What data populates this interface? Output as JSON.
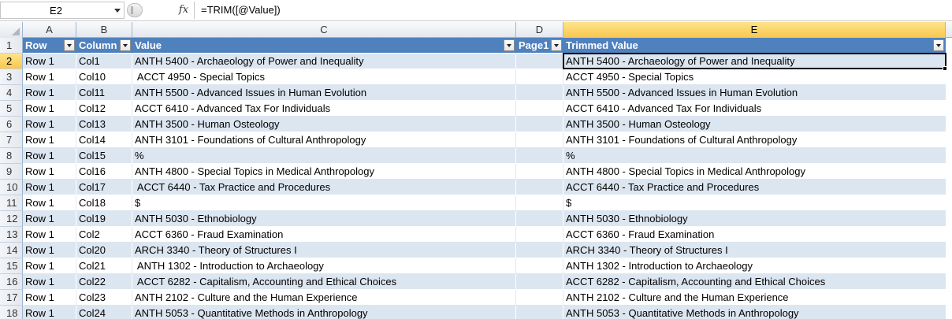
{
  "formula_bar": {
    "name_box": "E2",
    "fx_label": "fx",
    "formula": "=TRIM([@Value])"
  },
  "sheet": {
    "columns": [
      "A",
      "B",
      "C",
      "D",
      "E"
    ],
    "active_column": "E",
    "active_row": "2",
    "header_row": {
      "row_number": "1",
      "cells": [
        "Row",
        "Column",
        "Value",
        "Page1",
        "Trimmed Value"
      ]
    },
    "rows": [
      {
        "n": "2",
        "a": "Row 1",
        "b": "Col1",
        "c": "ANTH 5400 - Archaeology of Power and Inequality",
        "d": "",
        "e": "ANTH 5400 - Archaeology of Power and Inequality"
      },
      {
        "n": "3",
        "a": "Row 1",
        "b": "Col10",
        "c": " ACCT 4950 - Special Topics",
        "d": "",
        "e": "ACCT 4950 - Special Topics"
      },
      {
        "n": "4",
        "a": "Row 1",
        "b": "Col11",
        "c": "ANTH 5500 - Advanced Issues in Human Evolution",
        "d": "",
        "e": "ANTH 5500 - Advanced Issues in Human Evolution"
      },
      {
        "n": "5",
        "a": "Row 1",
        "b": "Col12",
        "c": "ACCT 6410 - Advanced Tax For Individuals",
        "d": "",
        "e": "ACCT 6410 - Advanced Tax For Individuals"
      },
      {
        "n": "6",
        "a": "Row 1",
        "b": "Col13",
        "c": "ANTH 3500 - Human Osteology",
        "d": "",
        "e": "ANTH 3500 - Human Osteology"
      },
      {
        "n": "7",
        "a": "Row 1",
        "b": "Col14",
        "c": "ANTH 3101 - Foundations of Cultural Anthropology",
        "d": "",
        "e": "ANTH 3101 - Foundations of Cultural Anthropology"
      },
      {
        "n": "8",
        "a": "Row 1",
        "b": "Col15",
        "c": "%",
        "d": "",
        "e": "%"
      },
      {
        "n": "9",
        "a": "Row 1",
        "b": "Col16",
        "c": "ANTH 4800 - Special Topics in Medical Anthropology",
        "d": "",
        "e": "ANTH 4800 - Special Topics in Medical Anthropology"
      },
      {
        "n": "10",
        "a": "Row 1",
        "b": "Col17",
        "c": " ACCT 6440 - Tax Practice and Procedures",
        "d": "",
        "e": "ACCT 6440 - Tax Practice and Procedures"
      },
      {
        "n": "11",
        "a": "Row 1",
        "b": "Col18",
        "c": "$",
        "d": "",
        "e": "$"
      },
      {
        "n": "12",
        "a": "Row 1",
        "b": "Col19",
        "c": "ANTH 5030 - Ethnobiology",
        "d": "",
        "e": "ANTH 5030 - Ethnobiology"
      },
      {
        "n": "13",
        "a": "Row 1",
        "b": "Col2",
        "c": "ACCT 6360 - Fraud Examination",
        "d": "",
        "e": "ACCT 6360 - Fraud Examination"
      },
      {
        "n": "14",
        "a": "Row 1",
        "b": "Col20",
        "c": "ARCH 3340 - Theory of Structures I",
        "d": "",
        "e": "ARCH 3340 - Theory of Structures I"
      },
      {
        "n": "15",
        "a": "Row 1",
        "b": "Col21",
        "c": " ANTH 1302 - Introduction to Archaeology",
        "d": "",
        "e": "ANTH 1302 - Introduction to Archaeology"
      },
      {
        "n": "16",
        "a": "Row 1",
        "b": "Col22",
        "c": " ACCT 6282 - Capitalism, Accounting and Ethical Choices",
        "d": "",
        "e": "ACCT 6282 - Capitalism, Accounting and Ethical Choices"
      },
      {
        "n": "17",
        "a": "Row 1",
        "b": "Col23",
        "c": "ANTH 2102 - Culture and the Human Experience",
        "d": "",
        "e": "ANTH 2102 - Culture and the Human Experience"
      },
      {
        "n": "18",
        "a": "Row 1",
        "b": "Col24",
        "c": "ANTH 5053 - Quantitative Methods in Anthropology",
        "d": "",
        "e": "ANTH 5053 - Quantitative Methods in Anthropology"
      }
    ]
  },
  "colors": {
    "table_header": "#4f81bd",
    "band": "#dce6f1",
    "active_header": "#f9c74f"
  }
}
